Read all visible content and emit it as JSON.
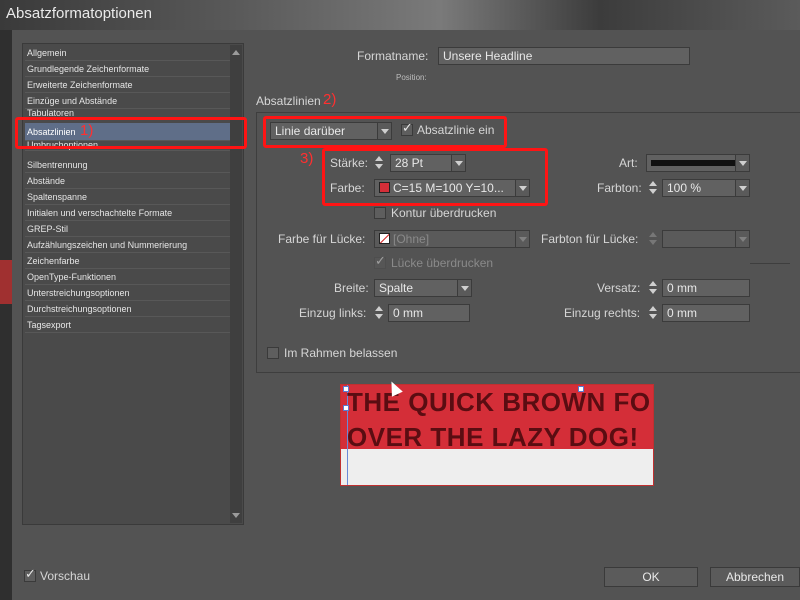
{
  "window": {
    "title": "Absatzformatoptionen"
  },
  "sidebar": {
    "items": [
      {
        "label": "Allgemein"
      },
      {
        "label": "Grundlegende Zeichenformate"
      },
      {
        "label": "Erweiterte Zeichenformate"
      },
      {
        "label": "Einzüge und Abstände"
      },
      {
        "label": "Tabulatoren"
      },
      {
        "label": "Absatzlinien",
        "selected": true
      },
      {
        "label": "Umbruchoptionen"
      },
      {
        "label": "Silbentrennung"
      },
      {
        "label": "Abstände"
      },
      {
        "label": "Spaltenspanne"
      },
      {
        "label": "Initialen und verschachtelte Formate"
      },
      {
        "label": "GREP-Stil"
      },
      {
        "label": "Aufzählungszeichen und Nummerierung"
      },
      {
        "label": "Zeichenfarbe"
      },
      {
        "label": "OpenType-Funktionen"
      },
      {
        "label": "Unterstreichungsoptionen"
      },
      {
        "label": "Durchstreichungsoptionen"
      },
      {
        "label": "Tagsexport"
      }
    ]
  },
  "header": {
    "formatname_label": "Formatname:",
    "formatname_value": "Unsere Headline",
    "position_label": "Position:"
  },
  "section": {
    "title": "Absatzlinien"
  },
  "annotations": {
    "one": "1)",
    "two": "2)",
    "three": "3)",
    "color": "#ff1414"
  },
  "rule": {
    "position_value": "Linie darüber",
    "enable_label": "Absatzlinie ein",
    "enabled": true,
    "staerke_label": "Stärke:",
    "staerke_value": "28 Pt",
    "art_label": "Art:",
    "farbe_label": "Farbe:",
    "farbe_value": "C=15 M=100 Y=10...",
    "farbe_swatch": "#d42e38",
    "farbton_label": "Farbton:",
    "farbton_value": "100 %",
    "kontur_label": "Kontur überdrucken",
    "luecke_farbe_label": "Farbe für Lücke:",
    "luecke_farbe_value": "[Ohne]",
    "luecke_farbton_label": "Farbton für Lücke:",
    "luecke_ueberdrucken_label": "Lücke überdrucken",
    "breite_label": "Breite:",
    "breite_value": "Spalte",
    "versatz_label": "Versatz:",
    "versatz_value": "0 mm",
    "einzug_links_label": "Einzug links:",
    "einzug_links_value": "0 mm",
    "einzug_rechts_label": "Einzug rechts:",
    "einzug_rechts_value": "0 mm",
    "im_rahmen_label": "Im Rahmen belassen"
  },
  "preview": {
    "line1": "THE QUICK BROWN FO",
    "line2": "OVER THE LAZY DOG!",
    "band_color": "#d42e38",
    "text_color": "#5a0d12"
  },
  "footer": {
    "vorschau_label": "Vorschau",
    "vorschau_checked": true,
    "ok_label": "OK",
    "cancel_label": "Abbrechen"
  }
}
